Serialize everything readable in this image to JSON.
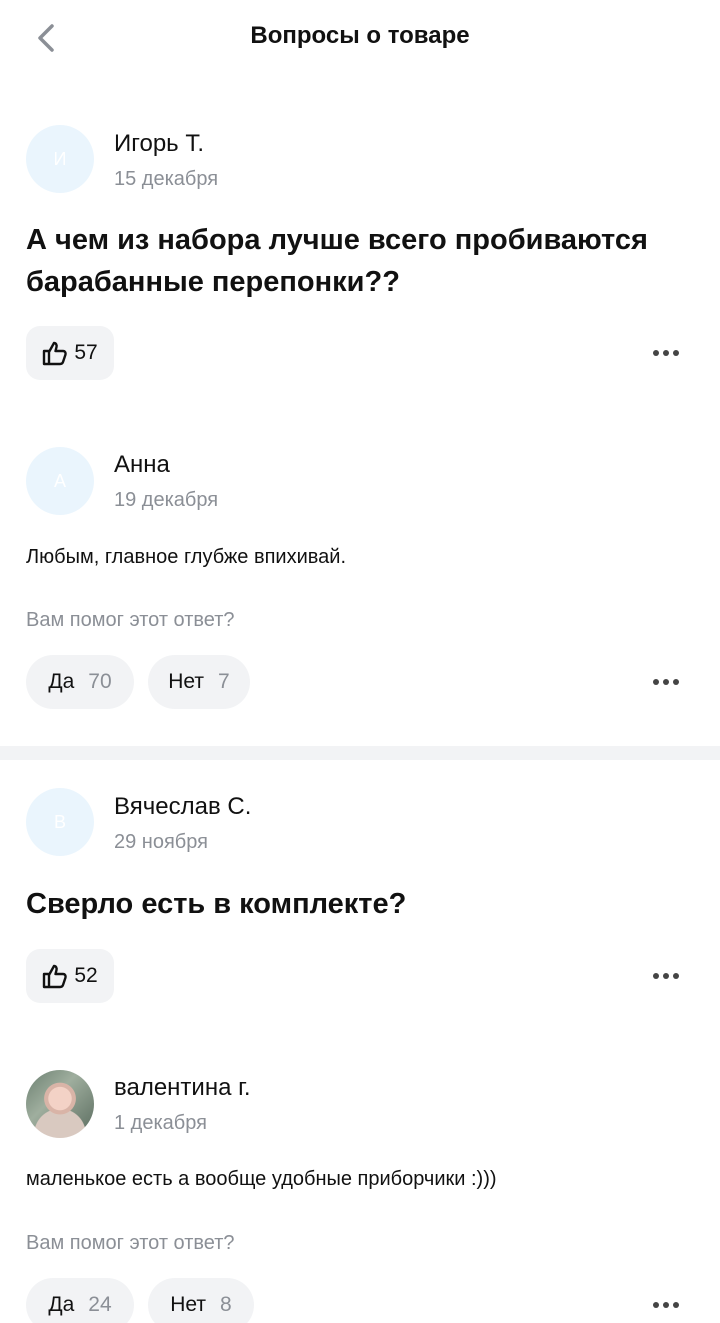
{
  "header": {
    "title": "Вопросы о товаре"
  },
  "questions": [
    {
      "author": "Игорь Т.",
      "avatar_letter": "И",
      "date": "15 декабря",
      "text": "А чем из набора лучше всего пробиваются барабанные перепонки??",
      "likes": "57",
      "answer": {
        "author": "Анна",
        "avatar_letter": "А",
        "date": "19 декабря",
        "text": "Любым, главное глубже впихивай.",
        "helpful_label": "Вам помог этот ответ?",
        "yes_label": "Да",
        "yes_count": "70",
        "no_label": "Нет",
        "no_count": "7"
      }
    },
    {
      "author": "Вячеслав С.",
      "avatar_letter": "В",
      "date": "29 ноября",
      "text": "Сверло есть в комплекте?",
      "likes": "52",
      "answer": {
        "author": "валентина г.",
        "date": "1 декабря",
        "text": "маленькое есть а вообще удобные приборчики :)))",
        "helpful_label": "Вам помог этот ответ?",
        "yes_label": "Да",
        "yes_count": "24",
        "no_label": "Нет",
        "no_count": "8"
      }
    }
  ]
}
